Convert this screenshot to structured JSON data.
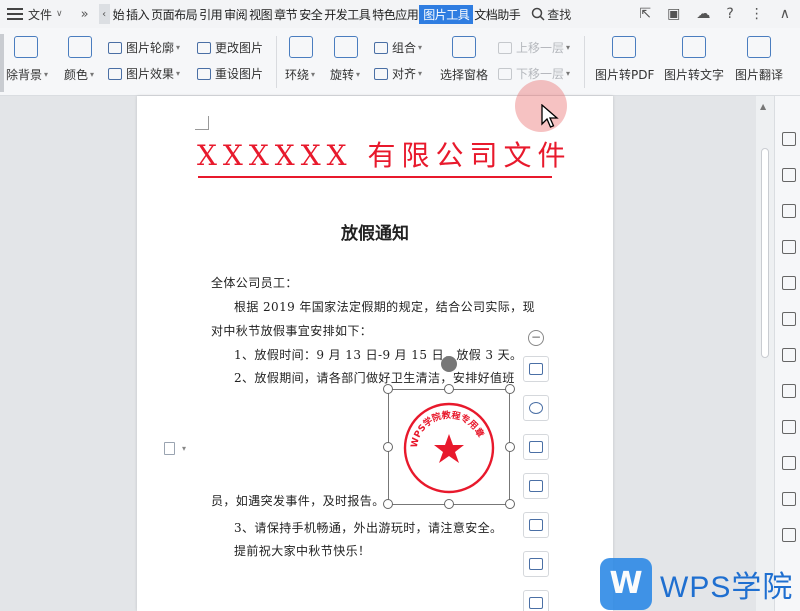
{
  "menu": {
    "file": "文件",
    "tabs": [
      "始",
      "插入",
      "页面布局",
      "引用",
      "审阅",
      "视图",
      "章节",
      "安全",
      "开发工具",
      "特色应用",
      "图片工具",
      "文档助手"
    ],
    "active_tab": "图片工具",
    "search": "查找"
  },
  "ribbon": {
    "remove_bg": "除背景",
    "color": "颜色",
    "outline": "图片轮廓",
    "effect": "图片效果",
    "change_pic": "更改图片",
    "reset_pic": "重设图片",
    "wrap": "环绕",
    "rotate": "旋转",
    "group": "组合",
    "align": "对齐",
    "select_pane": "选择窗格",
    "move_up": "上移一层",
    "move_down": "下移一层",
    "to_pdf": "图片转PDF",
    "to_text": "图片转文字",
    "translate": "图片翻译"
  },
  "document": {
    "title": "XXXXXX 有限公司文件",
    "notice": "放假通知",
    "salutation": "全体公司员工：",
    "p1a": "根据 2019 年国家法定假期的规定，结合公司实际，现",
    "p1b": "对中秋节放假事宜安排如下：",
    "item1": "1、放假时间：9 月 13 日-9 月 15 日，放假 3 天。",
    "item2": "2、放假期间，请各部门做好卫生清洁，安排好值班",
    "item2b": "员，如遇突发事件，及时报告。",
    "item3": "3、请保持手机畅通，外出游玩时，请注意安全。",
    "closing": "提前祝大家中秋节快乐！",
    "stamp_text": "WPS学院教程专用章"
  },
  "watermark": {
    "brand": "WPS学院",
    "logo_letter": "W"
  },
  "colors": {
    "accent": "#2f7de1",
    "red": "#e8192c"
  }
}
